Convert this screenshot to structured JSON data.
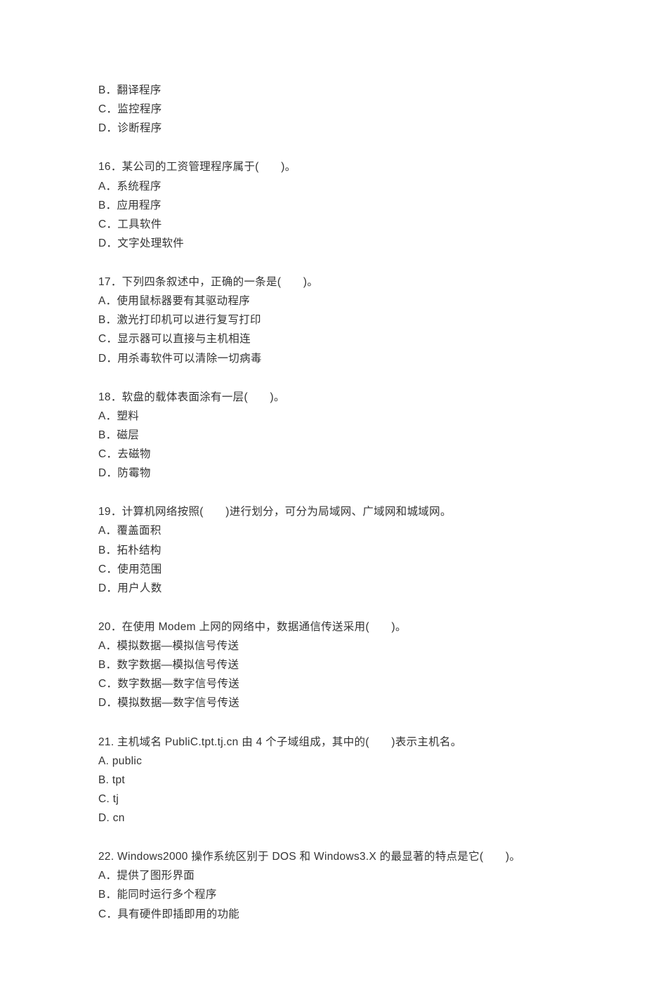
{
  "blocks": [
    {
      "lines": [
        "B．翻译程序",
        "C．监控程序",
        "D．诊断程序"
      ]
    },
    {
      "lines": [
        "16．某公司的工资管理程序属于(　　)。",
        "A．系统程序",
        "B．应用程序",
        "C．工具软件",
        "D．文字处理软件"
      ]
    },
    {
      "lines": [
        "17．下列四条叙述中，正确的一条是(　　)。",
        "A．使用鼠标器要有其驱动程序",
        "B．激光打印机可以进行复写打印",
        "C．显示器可以直接与主机相连",
        "D．用杀毒软件可以清除一切病毒"
      ]
    },
    {
      "lines": [
        "18．软盘的载体表面涂有一层(　　)。",
        "A．塑料",
        "B．磁层",
        "C．去磁物",
        "D．防霉物"
      ]
    },
    {
      "lines": [
        "19．计算机网络按照(　　)进行划分，可分为局域网、广域网和城域网。",
        "A．覆盖面积",
        "B．拓朴结构",
        "C．使用范围",
        "D．用户人数"
      ]
    },
    {
      "lines": [
        "20．在使用 Modem 上网的网络中，数据通信传送采用(　　)。",
        "A．模拟数据—模拟信号传送",
        "B．数字数据—模拟信号传送",
        "C．数字数据—数字信号传送",
        "D．模拟数据—数字信号传送"
      ]
    },
    {
      "lines": [
        "21. 主机域名 PubliC.tpt.tj.cn 由 4 个子域组成，其中的(　　)表示主机名。",
        "A. public",
        "B. tpt",
        "C. tj",
        "D. cn"
      ]
    },
    {
      "lines": [
        "22. Windows2000 操作系统区别于 DOS 和 Windows3.X 的最显著的特点是它(　　)。",
        "A．提供了图形界面",
        "B．能同时运行多个程序",
        "C．具有硬件即插即用的功能"
      ]
    }
  ]
}
